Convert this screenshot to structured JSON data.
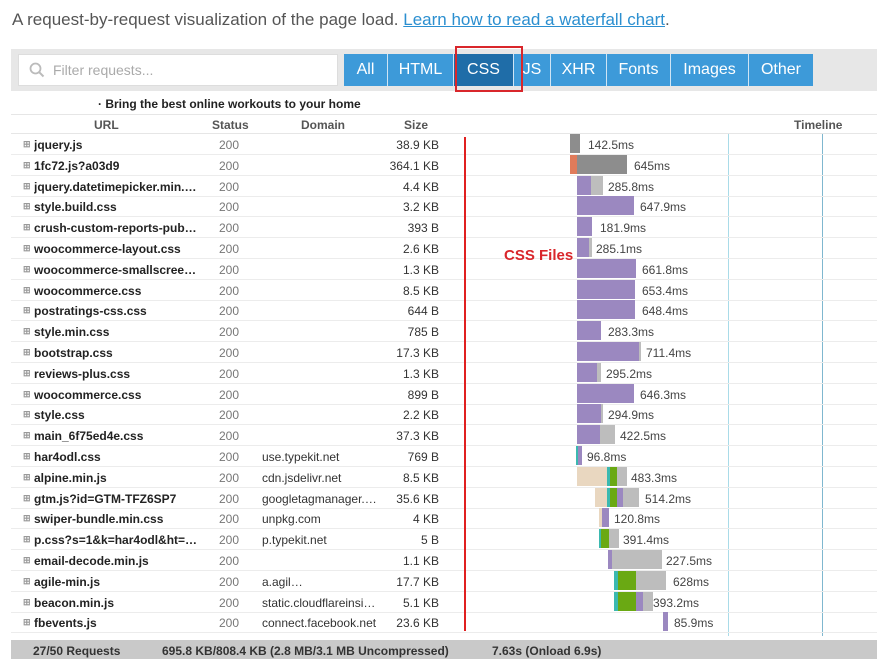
{
  "intro": {
    "text": "A request-by-request visualization of the page load. ",
    "link": "Learn how to read a waterfall chart",
    "period": "."
  },
  "search": {
    "placeholder": "Filter requests..."
  },
  "filters": [
    "All",
    "HTML",
    "CSS",
    "JS",
    "XHR",
    "Fonts",
    "Images",
    "Other"
  ],
  "active_filter": "CSS",
  "page_title": "· Bring the best online workouts to your home",
  "columns": {
    "url": "URL",
    "status": "Status",
    "domain": "Domain",
    "size": "Size",
    "timeline": "Timeline"
  },
  "annotation": "CSS Files",
  "colors": {
    "accent": "#3d9ad9",
    "active": "#1f6da8",
    "highlight": "#d9262b",
    "css_bar": "#9b88c0",
    "wait": "#e9d7c0",
    "gray": "#8d8d8d",
    "light_gray": "#bdbdbd",
    "green": "#6aa913",
    "teal": "#3bb9b0",
    "orange": "#e07b5b"
  },
  "requests": [
    {
      "url": "jquery.js",
      "status": "200",
      "domain": "",
      "size": "38.9 KB",
      "time": "142.5ms"
    },
    {
      "url": "1fc72.js?a03d9",
      "status": "200",
      "domain": "",
      "size": "364.1 KB",
      "time": "645ms"
    },
    {
      "url": "jquery.datetimepicker.min.…",
      "status": "200",
      "domain": "",
      "size": "4.4 KB",
      "time": "285.8ms"
    },
    {
      "url": "style.build.css",
      "status": "200",
      "domain": "",
      "size": "3.2 KB",
      "time": "647.9ms"
    },
    {
      "url": "crush-custom-reports-pub…",
      "status": "200",
      "domain": "",
      "size": "393 B",
      "time": "181.9ms"
    },
    {
      "url": "woocommerce-layout.css",
      "status": "200",
      "domain": "",
      "size": "2.6 KB",
      "time": "285.1ms"
    },
    {
      "url": "woocommerce-smallscree…",
      "status": "200",
      "domain": "",
      "size": "1.3 KB",
      "time": "661.8ms"
    },
    {
      "url": "woocommerce.css",
      "status": "200",
      "domain": "",
      "size": "8.5 KB",
      "time": "653.4ms"
    },
    {
      "url": "postratings-css.css",
      "status": "200",
      "domain": "",
      "size": "644 B",
      "time": "648.4ms"
    },
    {
      "url": "style.min.css",
      "status": "200",
      "domain": "",
      "size": "785 B",
      "time": "283.3ms"
    },
    {
      "url": "bootstrap.css",
      "status": "200",
      "domain": "",
      "size": "17.3 KB",
      "time": "711.4ms"
    },
    {
      "url": "reviews-plus.css",
      "status": "200",
      "domain": "",
      "size": "1.3 KB",
      "time": "295.2ms"
    },
    {
      "url": "woocommerce.css",
      "status": "200",
      "domain": "",
      "size": "899 B",
      "time": "646.3ms"
    },
    {
      "url": "style.css",
      "status": "200",
      "domain": "",
      "size": "2.2 KB",
      "time": "294.9ms"
    },
    {
      "url": "main_6f75ed4e.css",
      "status": "200",
      "domain": "",
      "size": "37.3 KB",
      "time": "422.5ms"
    },
    {
      "url": "har4odl.css",
      "status": "200",
      "domain": "use.typekit.net",
      "size": "769 B",
      "time": "96.8ms"
    },
    {
      "url": "alpine.min.js",
      "status": "200",
      "domain": "cdn.jsdelivr.net",
      "size": "8.5 KB",
      "time": "483.3ms"
    },
    {
      "url": "gtm.js?id=GTM-TFZ6SP7",
      "status": "200",
      "domain": "googletagmanager.c…",
      "size": "35.6 KB",
      "time": "514.2ms"
    },
    {
      "url": "swiper-bundle.min.css",
      "status": "200",
      "domain": "unpkg.com",
      "size": "4 KB",
      "time": "120.8ms"
    },
    {
      "url": "p.css?s=1&k=har4odl&ht=…",
      "status": "200",
      "domain": "p.typekit.net",
      "size": "5 B",
      "time": "391.4ms"
    },
    {
      "url": "email-decode.min.js",
      "status": "200",
      "domain": "",
      "size": "1.1 KB",
      "time": "227.5ms"
    },
    {
      "url": "agile-min.js",
      "status": "200",
      "domain": "a.agil…",
      "size": "17.7 KB",
      "time": "628ms"
    },
    {
      "url": "beacon.min.js",
      "status": "200",
      "domain": "static.cloudflareinsig…",
      "size": "5.1 KB",
      "time": "393.2ms"
    },
    {
      "url": "fbevents.js",
      "status": "200",
      "domain": "connect.facebook.net",
      "size": "23.6 KB",
      "time": "85.9ms"
    }
  ],
  "footer": {
    "requests": "27/50 Requests",
    "size": "695.8 KB/808.4 KB  (2.8 MB/3.1 MB Uncompressed)",
    "time": "7.63s  (Onload 6.9s)"
  }
}
